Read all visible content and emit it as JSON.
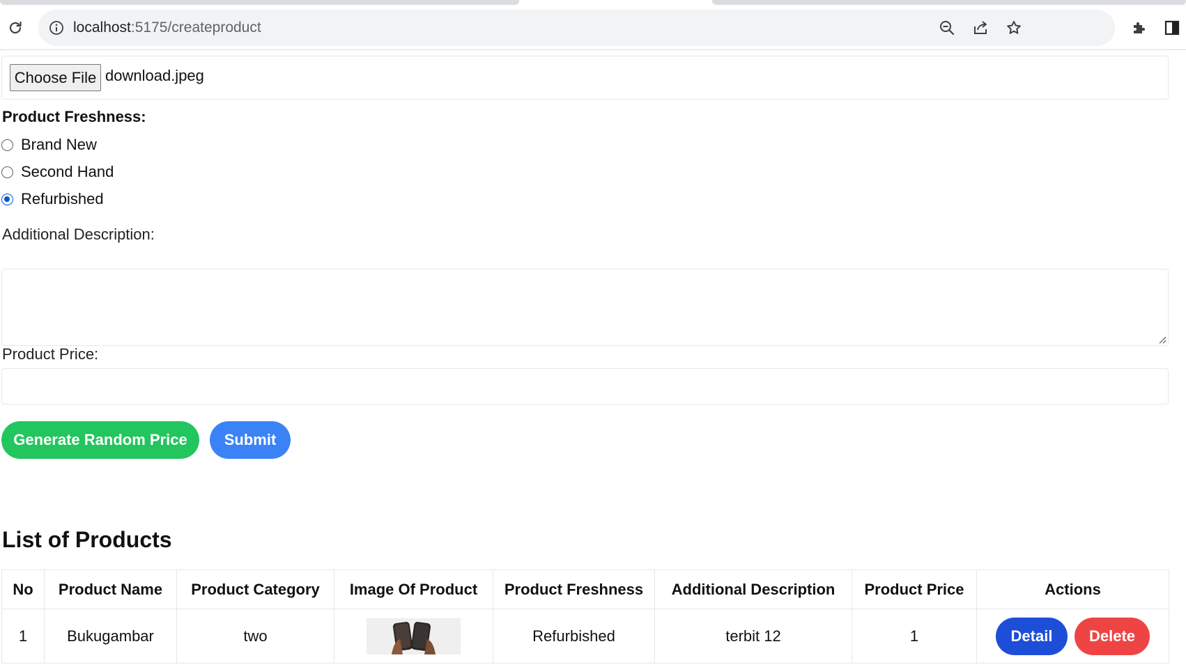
{
  "browser": {
    "url_host": "localhost",
    "url_path": ":5175/createproduct"
  },
  "form": {
    "file": {
      "button_label": "Choose File",
      "file_name": "download.jpeg"
    },
    "freshness": {
      "label": "Product Freshness:",
      "options": [
        "Brand New",
        "Second Hand",
        "Refurbished"
      ],
      "selected": "Refurbished"
    },
    "description": {
      "label": "Additional Description:",
      "value": ""
    },
    "price": {
      "label": "Product Price:",
      "value": ""
    },
    "buttons": {
      "generate_label": "Generate Random Price",
      "submit_label": "Submit"
    }
  },
  "products": {
    "title": "List of Products",
    "columns": [
      "No",
      "Product Name",
      "Product Category",
      "Image Of Product",
      "Product Freshness",
      "Additional Description",
      "Product Price",
      "Actions"
    ],
    "rows": [
      {
        "no": "1",
        "name": "Bukugambar",
        "category": "two",
        "image": "phones-thumbnail",
        "freshness": "Refurbished",
        "description": "terbit 12",
        "price": "1",
        "actions": {
          "detail_label": "Detail",
          "delete_label": "Delete"
        }
      }
    ]
  },
  "colors": {
    "green_button": "#22c55e",
    "blue_button": "#3b82f6",
    "detail_button": "#1d4ed8",
    "delete_button": "#ef4444",
    "radio_selected": "#0b57d0"
  },
  "icons": {
    "toolbar_left": [
      "reload-icon"
    ],
    "omnibox_left": [
      "info-icon"
    ],
    "omnibox_right": [
      "zoom-out-icon",
      "share-icon",
      "bookmark-star-icon"
    ],
    "toolbar_right": [
      "extensions-icon",
      "side-panel-icon"
    ]
  }
}
